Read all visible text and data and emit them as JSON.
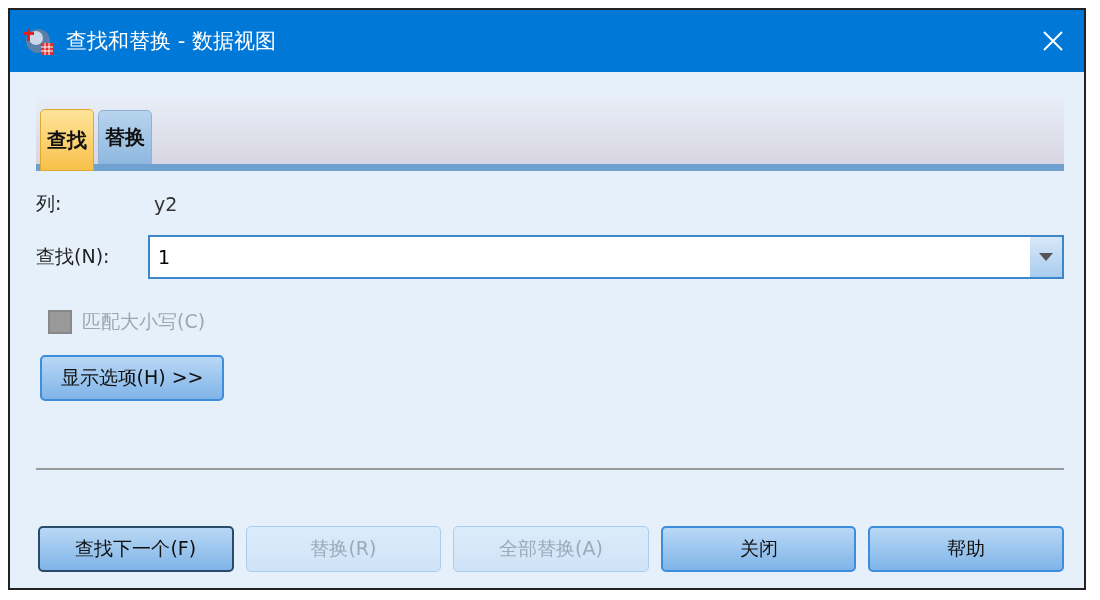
{
  "window": {
    "title": "查找和替换 - 数据视图"
  },
  "tabs": [
    {
      "label": "查找",
      "selected": true
    },
    {
      "label": "替换",
      "selected": false
    }
  ],
  "column": {
    "label": "列:",
    "value": "y2"
  },
  "find": {
    "label": "查找(N):",
    "value": "1"
  },
  "match_case": {
    "label": "匹配大小写(C)",
    "checked": false,
    "disabled": true
  },
  "options_button": {
    "label": "显示选项(H) >>"
  },
  "buttons": [
    {
      "label": "查找下一个(F)",
      "disabled": false,
      "default": true
    },
    {
      "label": "替换(R)",
      "disabled": true,
      "default": false
    },
    {
      "label": "全部替换(A)",
      "disabled": true,
      "default": false
    },
    {
      "label": "关闭",
      "disabled": false,
      "default": false
    },
    {
      "label": "帮助",
      "disabled": false,
      "default": false
    }
  ]
}
